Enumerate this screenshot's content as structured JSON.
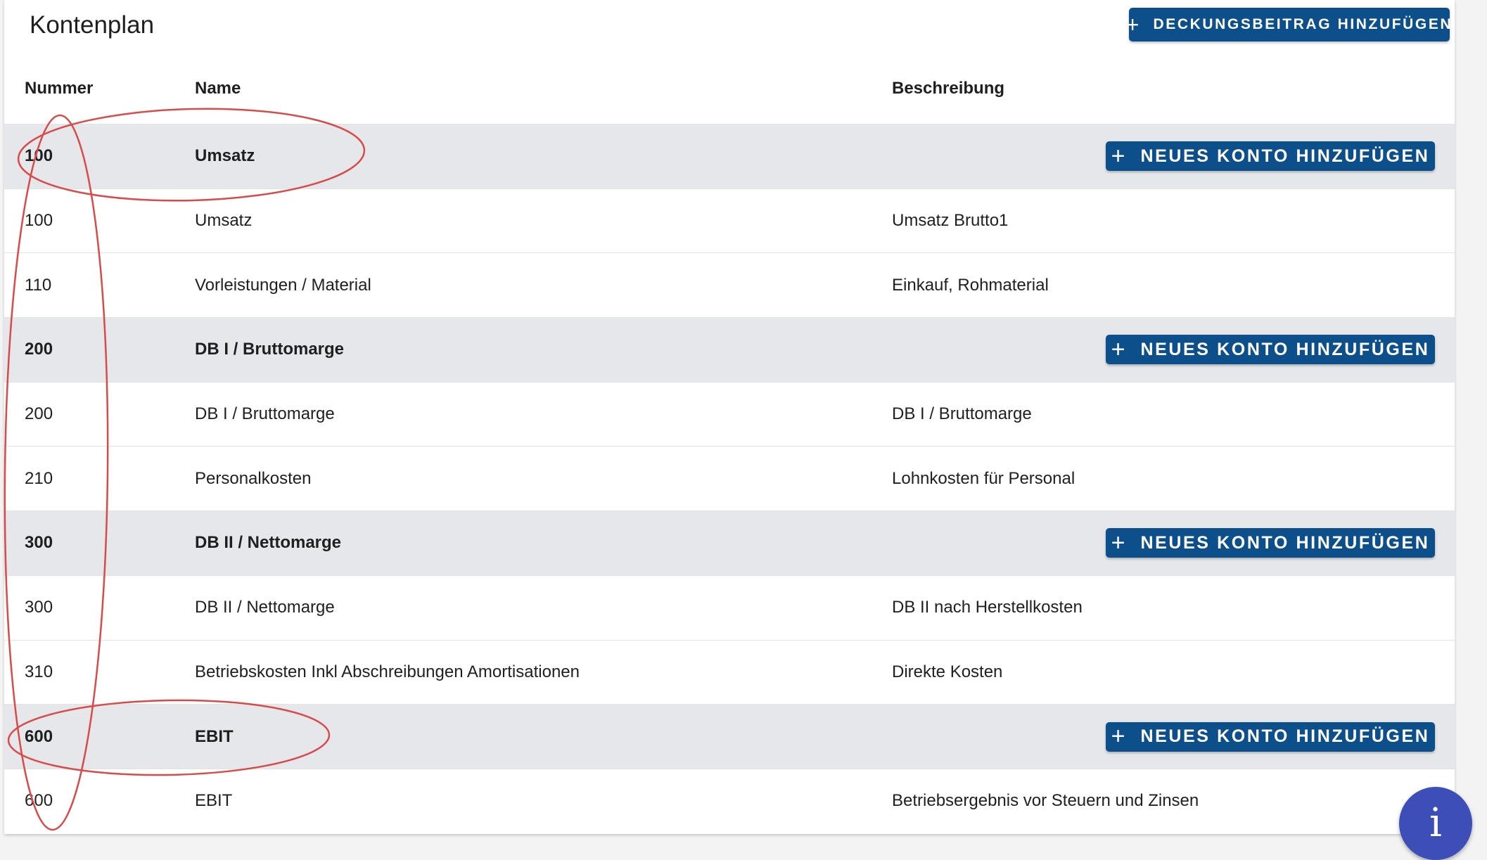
{
  "page": {
    "title": "Kontenplan",
    "add_margin_button": "Deckungsbeitrag hinzufügen"
  },
  "table": {
    "headers": {
      "number": "Nummer",
      "name": "Name",
      "description": "Beschreibung"
    },
    "groups": [
      {
        "number": "100",
        "name": "Umsatz",
        "add_label": "Neues Konto hinzufügen",
        "accounts": [
          {
            "number": "100",
            "name": "Umsatz",
            "description": "Umsatz Brutto1"
          },
          {
            "number": "110",
            "name": "Vorleistungen / Material",
            "description": "Einkauf, Rohmaterial"
          }
        ]
      },
      {
        "number": "200",
        "name": "DB I / Bruttomarge",
        "add_label": "Neues Konto hinzufügen",
        "accounts": [
          {
            "number": "200",
            "name": "DB I / Bruttomarge",
            "description": "DB I / Bruttomarge"
          },
          {
            "number": "210",
            "name": "Personalkosten",
            "description": "Lohnkosten für Personal"
          }
        ]
      },
      {
        "number": "300",
        "name": "DB II / Nettomarge",
        "add_label": "Neues Konto hinzufügen",
        "accounts": [
          {
            "number": "300",
            "name": "DB II / Nettomarge",
            "description": "DB II nach Herstellkosten"
          },
          {
            "number": "310",
            "name": "Betriebskosten Inkl Abschreibungen Amortisationen",
            "description": "Direkte Kosten"
          }
        ]
      },
      {
        "number": "600",
        "name": "EBIT",
        "add_label": "Neues Konto hinzufügen",
        "accounts": [
          {
            "number": "600",
            "name": "EBIT",
            "description": "Betriebsergebnis vor Steuern und Zinsen"
          }
        ]
      }
    ]
  },
  "info_button": {
    "glyph": "i",
    "icon": "info-icon",
    "color": "#3d4eb8"
  },
  "colors": {
    "primary_button": "#0d4f8b",
    "group_row_bg": "#e6e7ea",
    "annotation": "#d94a4a"
  },
  "plus_glyph": "+"
}
